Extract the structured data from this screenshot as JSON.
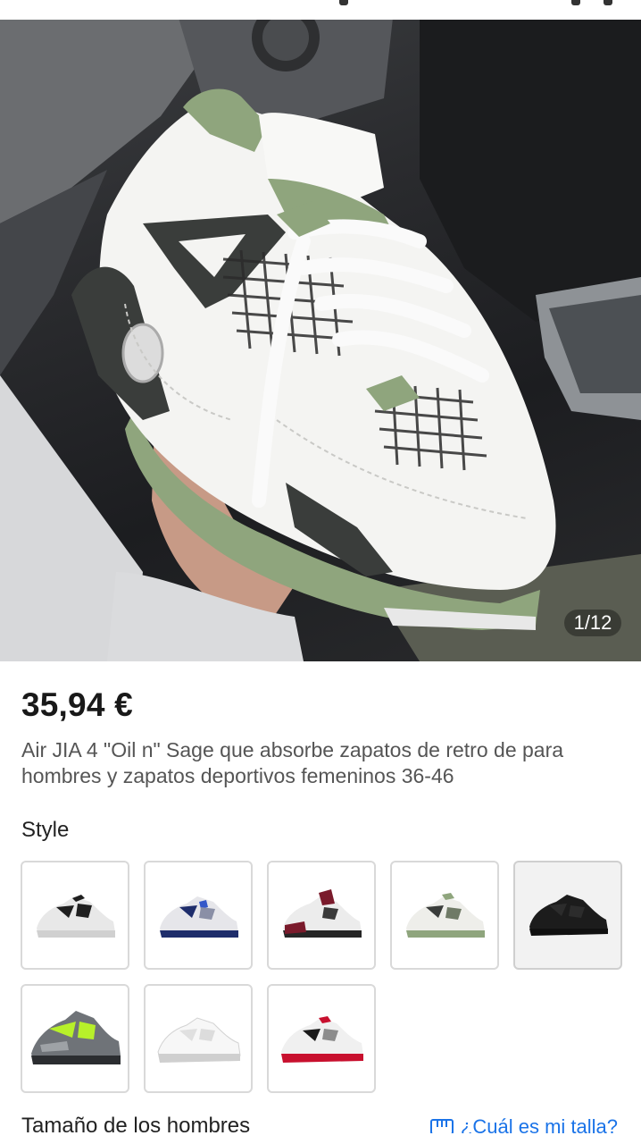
{
  "gallery": {
    "counter": "1/12",
    "image_alt": "product-photo"
  },
  "product": {
    "price": "35,94 €",
    "title": "Air JIA 4 \"Oil n\" Sage que absorbe zapatos de retro de para hombres y zapatos deportivos femeninos 36-46"
  },
  "style": {
    "label": "Style",
    "options": [
      {
        "accent": "#1f1f1f",
        "base": "#e8e8e8"
      },
      {
        "accent": "#1e2d6b",
        "base": "#e6e6ea"
      },
      {
        "accent": "#7a1a2b",
        "base": "#ececec"
      },
      {
        "accent": "#8fa57d",
        "base": "#eeeeea"
      },
      {
        "accent": "#151515",
        "base": "#1c1c1c"
      },
      {
        "accent": "#b7f02a",
        "base": "#6f7378"
      },
      {
        "accent": "#cfcfcf",
        "base": "#f2f2f2"
      },
      {
        "accent": "#c8102e",
        "base": "#f0f0f0"
      }
    ]
  },
  "size": {
    "label": "Tamaño de los hombres",
    "guide_label": "¿Cuál es mi talla?"
  },
  "colors": {
    "link": "#1a73e8",
    "price": "#191919"
  }
}
